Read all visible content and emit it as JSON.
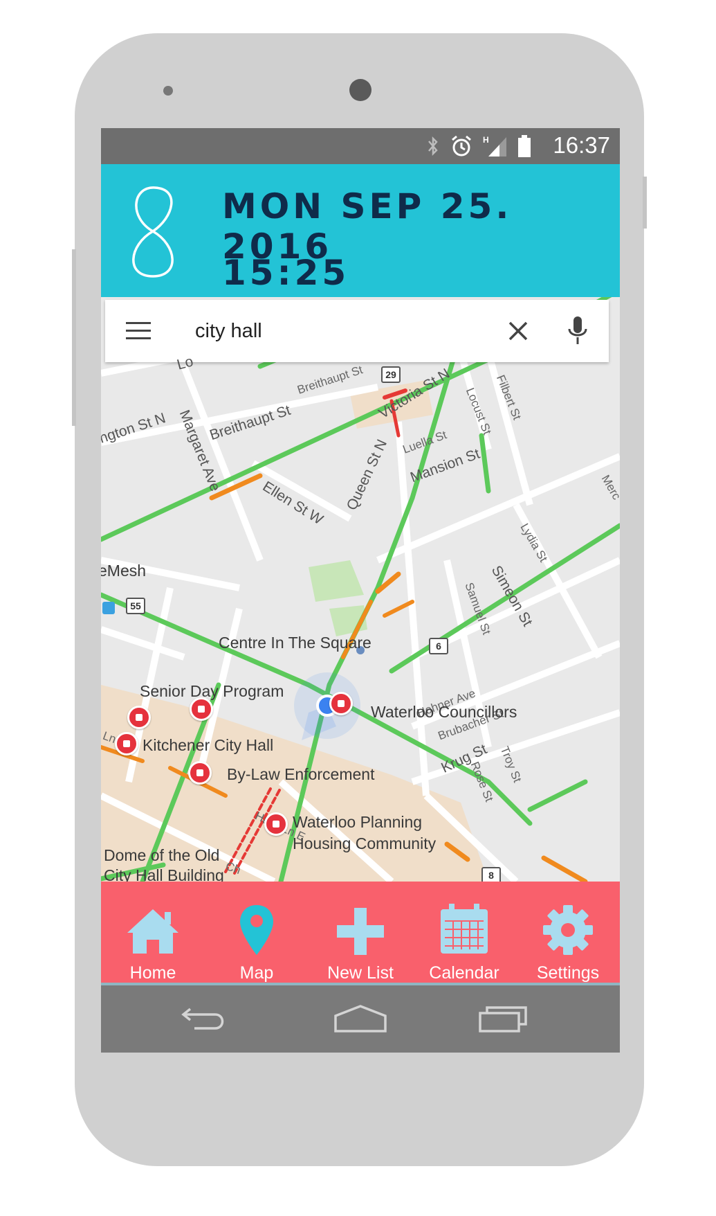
{
  "status_bar": {
    "time": "16:37",
    "icons": [
      "bluetooth-icon",
      "alarm-icon",
      "signal-icon",
      "battery-icon"
    ],
    "network": "H"
  },
  "header": {
    "date": "MON SEP 25. 2016",
    "time": "15:25",
    "logo": "infinity-logo",
    "background": "#23c3d6",
    "text_color": "#0f2b4a"
  },
  "search": {
    "value": "city hall",
    "icons": [
      "menu-icon",
      "close-icon",
      "mic-icon"
    ]
  },
  "map": {
    "places": [
      "Centre In The Square",
      "Senior Day Program",
      "Waterloo Councillors",
      "Kitchener City Hall",
      "By-Law Enforcement",
      "Waterloo Planning",
      "Housing Community",
      "Dome of the Old",
      "City Hall Building",
      "eMesh"
    ],
    "streets": [
      "ngton St N",
      "Breithaupt St",
      "Breithaupt St",
      "Margaret Ave",
      "Victoria St N",
      "Filbert St",
      "Locust St",
      "Luella St",
      "Mansion St",
      "Ellen St W",
      "Queen St N",
      "Lydia St",
      "Simeon St",
      "Samuel St",
      "Hohner Ave",
      "Brubacher St",
      "Krug St",
      "Rose St",
      "Troy St",
      "Halls Ln E",
      "Ln W",
      "Merc",
      "Lo",
      "Ch"
    ],
    "route_shields": [
      "29",
      "55",
      "6",
      "8"
    ],
    "colors": {
      "traffic_green": "#5cc95a",
      "traffic_orange": "#f08a1e",
      "traffic_red": "#e53935",
      "pin_red": "#e5323d",
      "location_blue": "#3b82f0"
    }
  },
  "nav": {
    "items": [
      {
        "label": "Home",
        "icon": "home-icon"
      },
      {
        "label": "Map",
        "icon": "map-pin-icon"
      },
      {
        "label": "New List",
        "icon": "plus-icon"
      },
      {
        "label": "Calendar",
        "icon": "calendar-icon"
      },
      {
        "label": "Settings",
        "icon": "gear-icon"
      }
    ],
    "background": "#f9606c",
    "active_color": "#23c3d6",
    "icon_color": "#a9dcef"
  },
  "system_nav": {
    "icons": [
      "back-icon",
      "home-outline-icon",
      "recents-icon"
    ]
  }
}
